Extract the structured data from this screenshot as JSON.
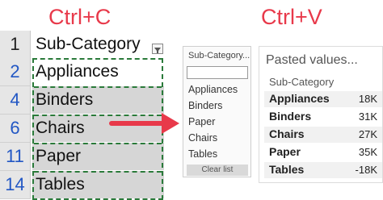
{
  "headings": {
    "copy": "Ctrl+C",
    "paste": "Ctrl+V"
  },
  "sheet": {
    "header": {
      "row": "1",
      "value": "Sub-Category"
    },
    "rows": [
      {
        "row": "2",
        "value": "Appliances"
      },
      {
        "row": "4",
        "value": "Binders"
      },
      {
        "row": "6",
        "value": "Chairs"
      },
      {
        "row": "11",
        "value": "Paper"
      },
      {
        "row": "14",
        "value": "Tables"
      }
    ]
  },
  "filter_card": {
    "title": "Sub-Category...",
    "search_placeholder": "",
    "items": [
      "Appliances",
      "Binders",
      "Paper",
      "Chairs",
      "Tables"
    ],
    "clear_label": "Clear list"
  },
  "pasted": {
    "title": "Pasted values...",
    "subtitle": "Sub-Category",
    "rows": [
      {
        "name": "Appliances",
        "value": "18K"
      },
      {
        "name": "Binders",
        "value": "31K"
      },
      {
        "name": "Chairs",
        "value": "27K"
      },
      {
        "name": "Paper",
        "value": "35K"
      },
      {
        "name": "Tables",
        "value": "-18K"
      }
    ]
  },
  "colors": {
    "accent": "#e8394a",
    "selection": "#2a7a3a"
  }
}
